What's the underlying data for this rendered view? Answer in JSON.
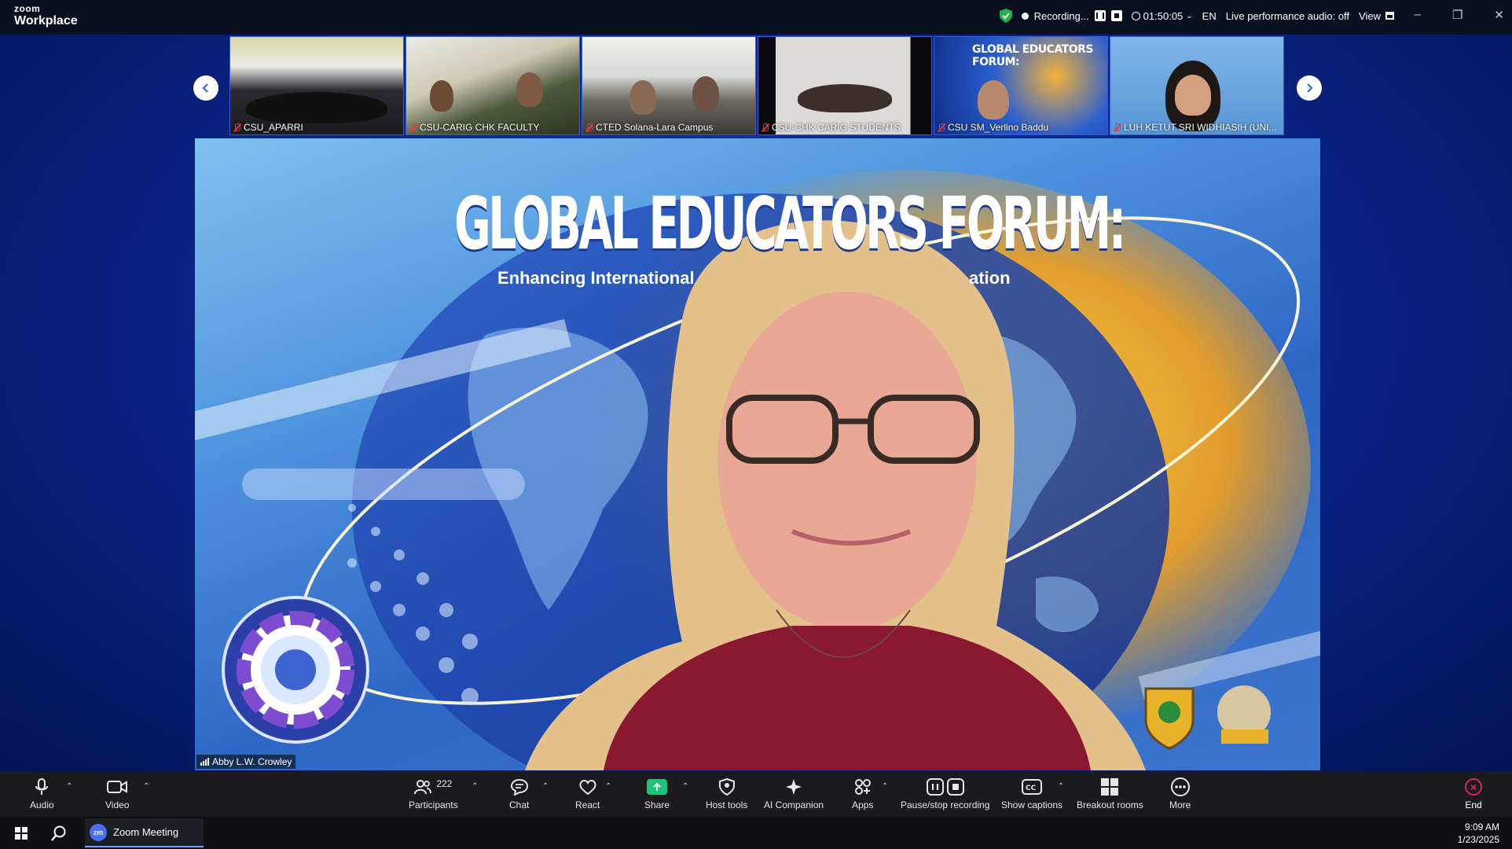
{
  "app": {
    "brand_top": "zoom",
    "brand_bottom": "Workplace"
  },
  "titlebar": {
    "recording_label": "Recording...",
    "timer": "01:50:05",
    "language": "EN",
    "audio_status": "Live performance audio: off",
    "view_label": "View",
    "minimize": "–",
    "restore": "❐",
    "close": "✕"
  },
  "thumbnails": [
    {
      "name": "CSU_APARRI"
    },
    {
      "name": "CSU-CARIG CHK FACULTY"
    },
    {
      "name": "CTED Solana-Lara Campus"
    },
    {
      "name": "CSU-CHK CARIG STUDENTS"
    },
    {
      "name": "CSU SM_Verlino Baddu"
    },
    {
      "name": "LUH KETUT SRI WIDHIASIH (UNI..."
    }
  ],
  "thumb_forum_mini": "GLOBAL EDUCATORS FORUM:",
  "main_video": {
    "title": "GLOBAL EDUCATORS FORUM:",
    "subtitle_left": "Enhancing International",
    "subtitle_right": "ation",
    "speaker": "Abby L.W. Crowley"
  },
  "toolbar": {
    "audio": "Audio",
    "video": "Video",
    "participants": "Participants",
    "participants_count": "222",
    "chat": "Chat",
    "react": "React",
    "share": "Share",
    "host_tools": "Host tools",
    "ai_companion": "AI Companion",
    "apps": "Apps",
    "pause_recording": "Pause/stop recording",
    "show_captions": "Show captions",
    "breakout_rooms": "Breakout rooms",
    "more": "More",
    "end": "End"
  },
  "taskbar": {
    "app_label": "Zoom Meeting",
    "app_badge": "zm",
    "time": "9:09 AM",
    "date": "1/23/2025"
  },
  "colors": {
    "share_green": "#1ec27a",
    "end_red": "#e0245e",
    "stage_blue": "#0a2382"
  }
}
